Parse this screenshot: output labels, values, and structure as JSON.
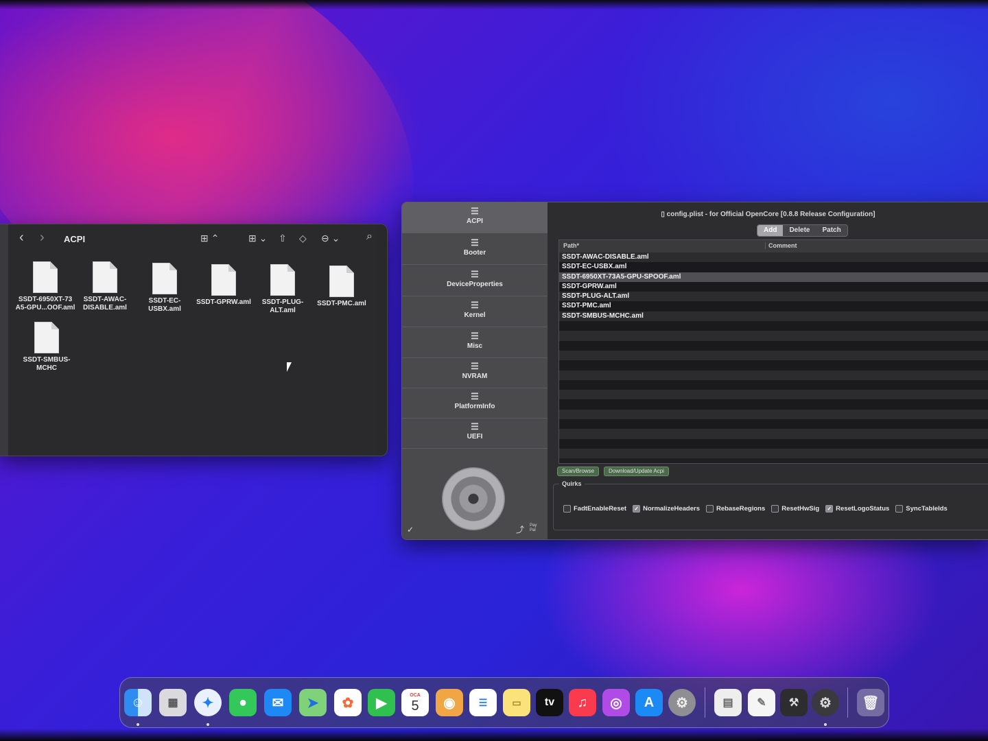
{
  "finder": {
    "title": "ACPI",
    "toolbar": {
      "back": "‹",
      "forward": "›",
      "view": "⊞ ⌃",
      "group": "⊞ ⌄",
      "share": "⇧",
      "tag": "◇",
      "more": "⊖ ⌄",
      "search": "⌕"
    },
    "files": [
      "SSDT-6950XT-73 A5-GPU...OOF.aml",
      "SSDT-AWAC- DISABLE.aml",
      "SSDT-EC- USBX.aml",
      "SSDT-GPRW.aml",
      "SSDT-PLUG- ALT.aml",
      "SSDT-PMC.aml",
      "SSDT-SMBUS- MCHC"
    ]
  },
  "occ": {
    "title": "config.plist - for Official OpenCore [0.8.8 Release Configuration]",
    "nav": [
      "ACPI",
      "Booter",
      "DeviceProperties",
      "Kernel",
      "Misc",
      "NVRAM",
      "PlatformInfo",
      "UEFI"
    ],
    "segments": [
      "Add",
      "Delete",
      "Patch"
    ],
    "columns": {
      "path": "Path*",
      "comment": "Comment"
    },
    "rows": [
      "SSDT-AWAC-DISABLE.aml",
      "SSDT-EC-USBX.aml",
      "SSDT-6950XT-73A5-GPU-SPOOF.aml",
      "SSDT-GPRW.aml",
      "SSDT-PLUG-ALT.aml",
      "SSDT-PMC.aml",
      "SSDT-SMBUS-MCHC.aml"
    ],
    "buttons": {
      "scan": "Scan/Browse",
      "download": "Download/Update Acpi"
    },
    "quirks_title": "Quirks",
    "quirks": [
      {
        "label": "FadtEnableReset",
        "checked": false
      },
      {
        "label": "NormalizeHeaders",
        "checked": true
      },
      {
        "label": "RebaseRegions",
        "checked": false
      },
      {
        "label": "ResetHwSig",
        "checked": false
      },
      {
        "label": "ResetLogoStatus",
        "checked": true
      },
      {
        "label": "SyncTableIds",
        "checked": false
      }
    ],
    "footer": {
      "share_icon": "share-icon",
      "paypal": "Pay Pal"
    }
  },
  "dock": {
    "calendar": {
      "month": "OCA",
      "day": "5"
    },
    "tv_label": "tv",
    "apps": [
      "finder",
      "launchpad",
      "safari",
      "messages",
      "mail",
      "maps",
      "photos",
      "facetime",
      "calendar",
      "contacts",
      "reminders",
      "notes",
      "tv",
      "music",
      "podcasts",
      "app-store",
      "system-settings",
      "preview-app",
      "textedit",
      "opencore-configurator",
      "settings-gear",
      "trash"
    ]
  },
  "colors": {
    "accent": "#a6a6aa",
    "selected_row": "#4f4f54"
  }
}
